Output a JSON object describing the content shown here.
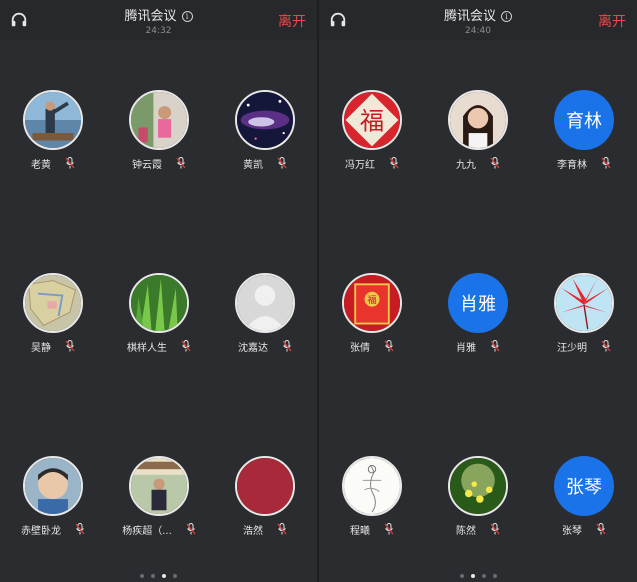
{
  "left": {
    "title": "腾讯会议",
    "clock": "24:32",
    "leave_label": "离开",
    "participants": [
      {
        "name": "老黄",
        "avatar": "photo-lake"
      },
      {
        "name": "钟云霞",
        "avatar": "photo-child-garden"
      },
      {
        "name": "黄凯",
        "avatar": "photo-galaxy"
      },
      {
        "name": "吴静",
        "avatar": "photo-map"
      },
      {
        "name": "棋样人生",
        "avatar": "photo-grass"
      },
      {
        "name": "沈嘉达",
        "avatar": "default-person"
      },
      {
        "name": "赤壁卧龙",
        "avatar": "photo-boy"
      },
      {
        "name": "杨疾超（...",
        "avatar": "photo-man-gate"
      },
      {
        "name": "浩然",
        "avatar": "solid-red"
      }
    ],
    "page_dots": 4,
    "active_dot": 2
  },
  "right": {
    "title": "腾讯会议",
    "clock": "24:40",
    "leave_label": "离开",
    "participants": [
      {
        "name": "冯万红",
        "avatar": "photo-fu-red"
      },
      {
        "name": "九九",
        "avatar": "photo-woman"
      },
      {
        "name": "李育林",
        "avatar": "text",
        "avatar_text": "育林"
      },
      {
        "name": "张倩",
        "avatar": "photo-red-envelope"
      },
      {
        "name": "肖雅",
        "avatar": "text",
        "avatar_text": "肖雅"
      },
      {
        "name": "汪少明",
        "avatar": "photo-red-leaf"
      },
      {
        "name": "程曦",
        "avatar": "photo-sketch"
      },
      {
        "name": "陈然",
        "avatar": "photo-flowers"
      },
      {
        "name": "张琴",
        "avatar": "text",
        "avatar_text": "张琴"
      }
    ],
    "page_dots": 4,
    "active_dot": 1
  },
  "colors": {
    "leave": "#f04848",
    "avatar_blue": "#1a73e8",
    "mic_red": "#e03c3c",
    "background": "#2b2c30"
  },
  "icons": {
    "headphones": "headphones-icon",
    "info": "info-icon",
    "mic": "mic-muted-icon"
  }
}
